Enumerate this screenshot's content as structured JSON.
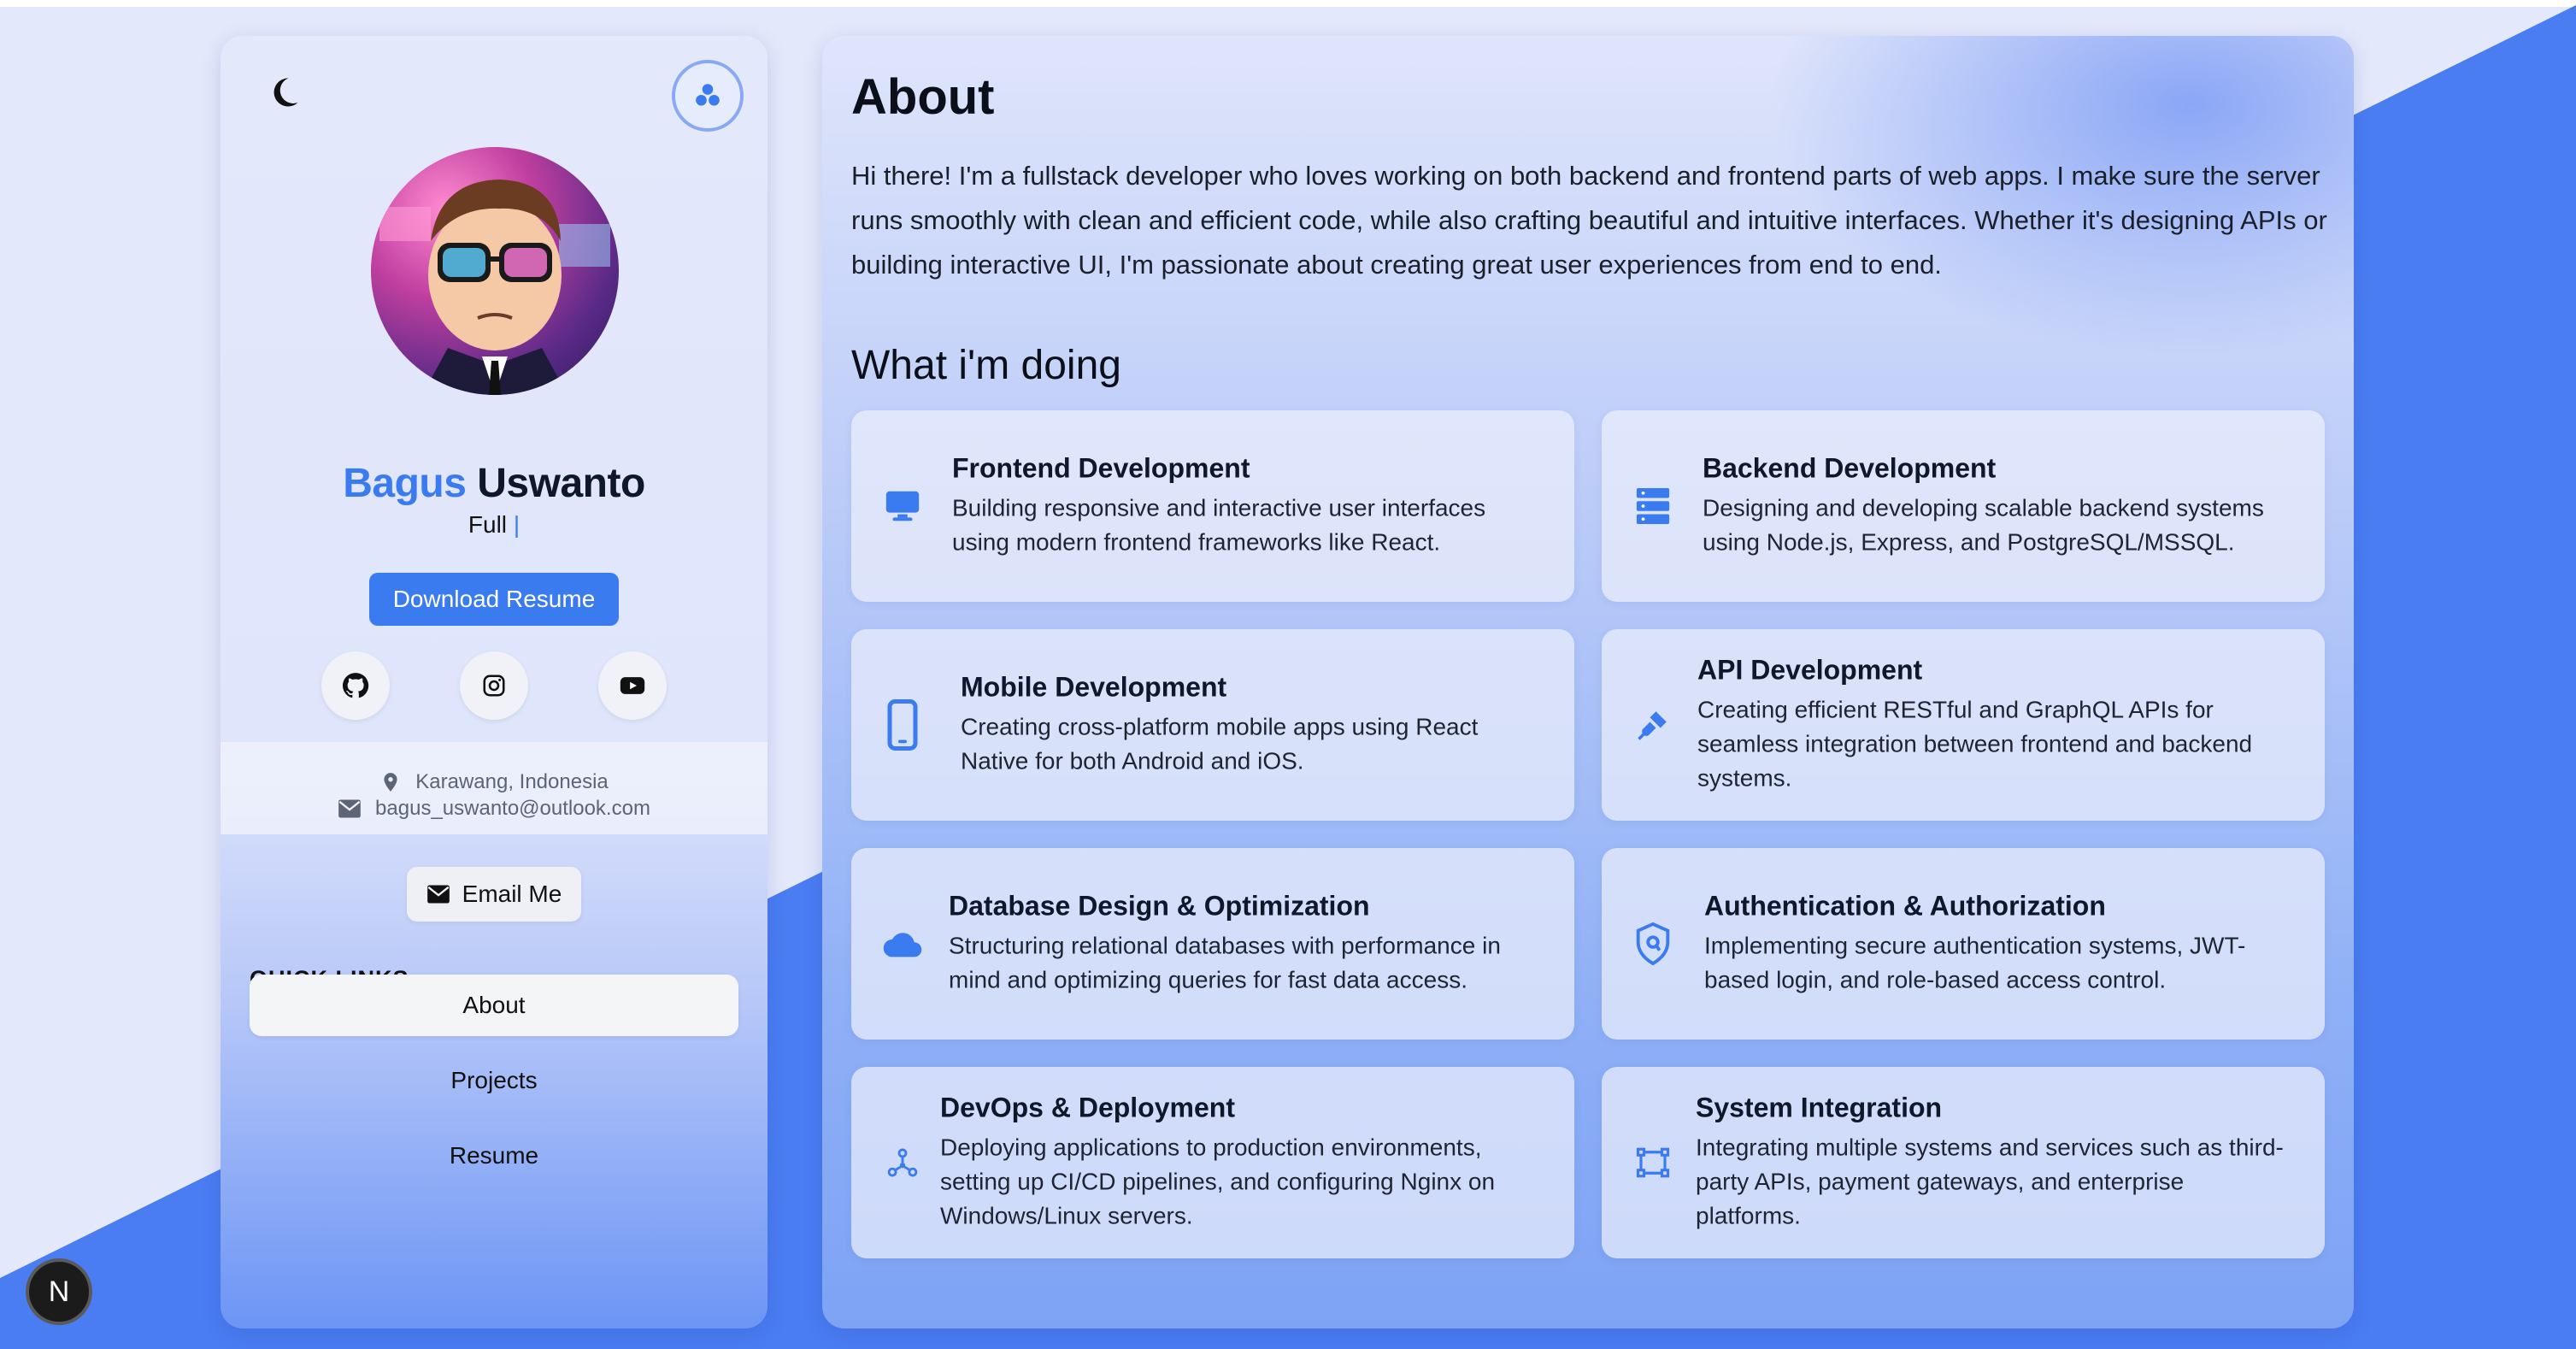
{
  "sidebar": {
    "name_first": "Bagus",
    "name_last": "Uswanto",
    "role": "Full",
    "role_caret": "|",
    "download_label": "Download Resume",
    "location": "Karawang, Indonesia",
    "email": "bagus_uswanto@outlook.com",
    "email_button": "Email Me",
    "quick_links_title": "QUICK LINKS",
    "nav": [
      {
        "label": "About",
        "active": true
      },
      {
        "label": "Projects",
        "active": false
      },
      {
        "label": "Resume",
        "active": false
      }
    ],
    "socials": [
      "github-icon",
      "instagram-icon",
      "youtube-icon"
    ]
  },
  "main": {
    "about_title": "About",
    "about_text": "Hi there! I'm a fullstack developer who loves working on both backend and frontend parts of web apps. I make sure the server runs smoothly with clean and efficient code, while also crafting beautiful and intuitive interfaces. Whether it's designing APIs or building interactive UI, I'm passionate about creating great user experiences from end to end.",
    "doing_title": "What i'm doing",
    "services": [
      {
        "title": "Frontend Development",
        "desc": "Building responsive and interactive user interfaces using modern frontend frameworks like React.",
        "icon": "monitor-icon"
      },
      {
        "title": "Backend Development",
        "desc": "Designing and developing scalable backend systems using Node.js, Express, and PostgreSQL/MSSQL.",
        "icon": "server-icon"
      },
      {
        "title": "Mobile Development",
        "desc": "Creating cross-platform mobile apps using React Native for both Android and iOS.",
        "icon": "mobile-icon"
      },
      {
        "title": "API Development",
        "desc": "Creating efficient RESTful and GraphQL APIs for seamless integration between frontend and backend systems.",
        "icon": "plug-icon"
      },
      {
        "title": "Database Design & Optimization",
        "desc": "Structuring relational databases with performance in mind and optimizing queries for fast data access.",
        "icon": "cloud-icon"
      },
      {
        "title": "Authentication & Authorization",
        "desc": "Implementing secure authentication systems, JWT-based login, and role-based access control.",
        "icon": "shield-icon"
      },
      {
        "title": "DevOps & Deployment",
        "desc": "Deploying applications to production environments, setting up CI/CD pipelines, and configuring Nginx on Windows/Linux servers.",
        "icon": "network-icon"
      },
      {
        "title": "System Integration",
        "desc": "Integrating multiple systems and services such as third-party APIs, payment gateways, and enterprise platforms.",
        "icon": "integration-icon"
      }
    ]
  },
  "badge": {
    "label": "N"
  },
  "colors": {
    "accent": "#3b7bf0",
    "background_shape": "#4a7cf2"
  }
}
